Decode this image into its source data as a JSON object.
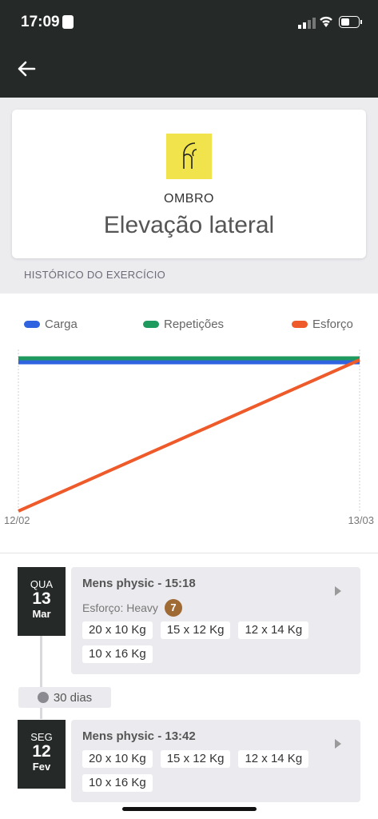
{
  "status_bar": {
    "time": "17:09"
  },
  "header": {
    "back_icon": "arrow-left-icon"
  },
  "exercise": {
    "icon": "shoulder-icon",
    "muscle_group": "OMBRO",
    "name": "Elevação lateral"
  },
  "section_title": "HISTÓRICO DO EXERCÍCIO",
  "colors": {
    "carga": "#2f63e0",
    "repeticoes": "#1f9a5e",
    "esforco": "#ef5a2a",
    "dark": "#252a28"
  },
  "chart_data": {
    "type": "line",
    "x": [
      "12/02",
      "13/03"
    ],
    "series": [
      {
        "name": "Carga",
        "values": [
          1,
          1
        ]
      },
      {
        "name": "Repetições",
        "values": [
          1,
          1
        ]
      },
      {
        "name": "Esforço",
        "values": [
          0,
          1
        ]
      }
    ],
    "legend": "top",
    "grid": false
  },
  "history": [
    {
      "dow": "QUA",
      "day": "13",
      "month": "Mar",
      "title": "Mens physic - 15:18",
      "effort_label": "Esforço: Heavy",
      "effort_value": "7",
      "sets": [
        "20  x 10 Kg",
        "15  x 12 Kg",
        "12  x 14 Kg",
        "10  x 16 Kg"
      ]
    },
    {
      "dow": "SEG",
      "day": "12",
      "month": "Fev",
      "title": "Mens physic - 13:42",
      "sets": [
        "20  x 10 Kg",
        "15  x 12 Kg",
        "12  x 14 Kg",
        "10  x 16 Kg"
      ]
    }
  ],
  "gap": {
    "text": "30 dias"
  }
}
